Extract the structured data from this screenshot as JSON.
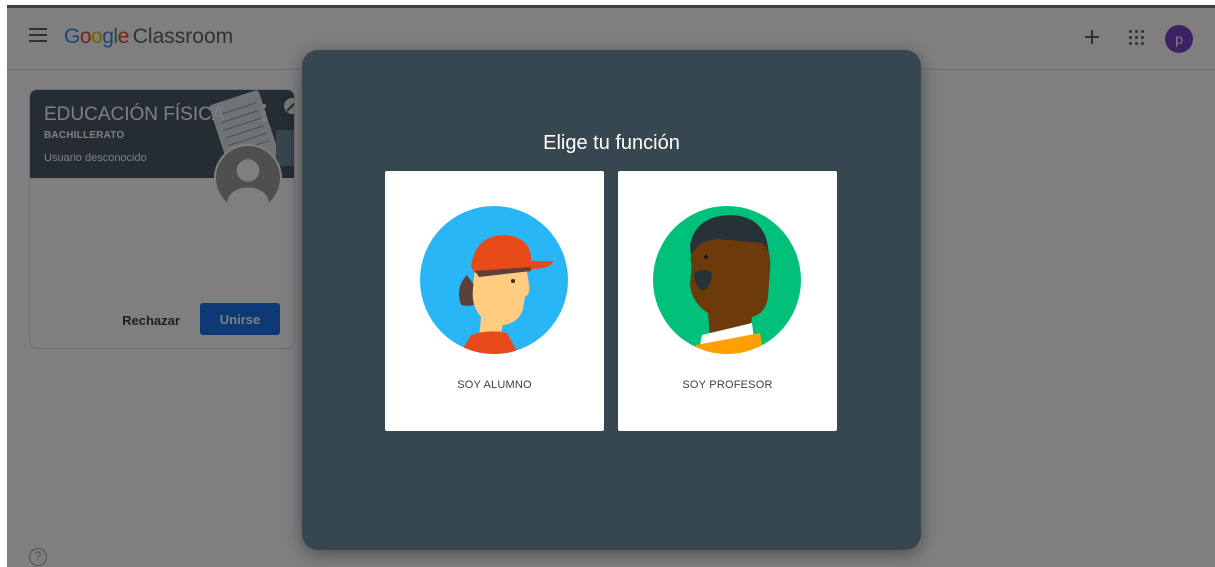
{
  "header": {
    "menu_icon": "hamburger-menu-icon",
    "brand_google": [
      "G",
      "o",
      "o",
      "g",
      "l",
      "e"
    ],
    "brand_colors": [
      "#4285F4",
      "#EA4335",
      "#FBBC05",
      "#4285F4",
      "#34A853",
      "#EA4335"
    ],
    "app_name": "Classroom",
    "add_icon": "plus-icon",
    "apps_icon": "apps-grid-icon",
    "avatar_initial": "p",
    "avatar_color": "#7b42c6"
  },
  "class_card": {
    "title": "EDUCACIÓN FÍSICA",
    "section": "BACHILLERATO",
    "owner": "Usuario desconocido",
    "reject_label": "Rechazar",
    "join_label": "Unirse",
    "header_color": "#4a5966",
    "join_color": "#1a73e8"
  },
  "help_icon": "help-circle-icon",
  "dialog": {
    "title": "Elige tu función",
    "background": "#37474f",
    "roles": [
      {
        "label": "SOY ALUMNO",
        "circle_color": "#29b6f6"
      },
      {
        "label": "SOY PROFESOR",
        "circle_color": "#00c07a"
      }
    ]
  }
}
